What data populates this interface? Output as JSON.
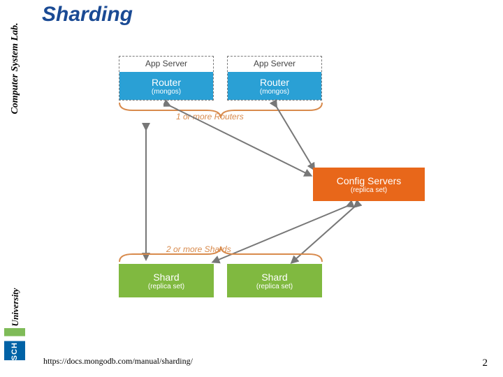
{
  "sidebar": {
    "lab_text": "Computer System Lab.",
    "uni_text": "University",
    "logo_text": "SCH"
  },
  "title": "Sharding",
  "diagram": {
    "app_server_label": "App Server",
    "router": {
      "title": "Router",
      "subtitle": "(mongos)"
    },
    "ann_routers": "1 or more Routers",
    "ann_shards": "2 or more Shards",
    "config": {
      "title": "Config Servers",
      "subtitle": "(replica set)"
    },
    "shard": {
      "title": "Shard",
      "subtitle": "(replica set)"
    }
  },
  "footer_url": "https://docs.mongodb.com/manual/sharding/",
  "page_number": "2"
}
